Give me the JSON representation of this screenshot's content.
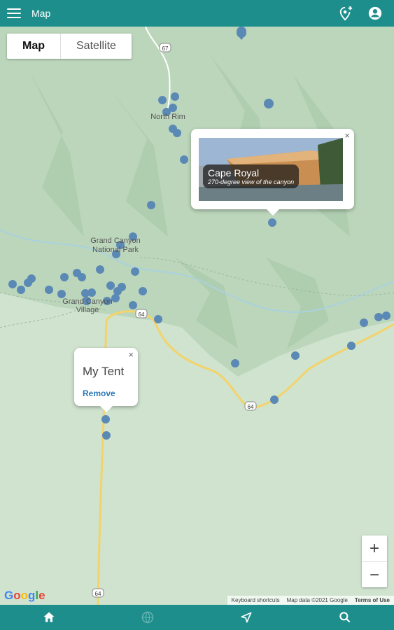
{
  "header": {
    "title": "Map"
  },
  "map_type": {
    "map_label": "Map",
    "satellite_label": "Satellite",
    "selected": "Map"
  },
  "popups": {
    "cape_royal": {
      "title": "Cape Royal",
      "subtitle": "270-degree view of the canyon",
      "close": "×"
    },
    "my_tent": {
      "title": "My Tent",
      "action": "Remove",
      "close": "×"
    }
  },
  "map_labels": {
    "north_rim": "North Rim",
    "park_line1": "Grand Canyon",
    "park_line2": "National Park",
    "village_line1": "Grand Canyon",
    "village_line2": "Village",
    "route_67": "67",
    "route_64a": "64",
    "route_64b": "64",
    "route_64c": "64"
  },
  "zoom": {
    "plus": "+",
    "minus": "−"
  },
  "attribution": {
    "logo": "Google",
    "shortcuts": "Keyboard shortcuts",
    "map_data": "Map data ©2021 Google",
    "terms": "Terms of Use"
  },
  "bottom_nav": [
    "home-icon",
    "globe-icon",
    "navigation-icon",
    "search-icon"
  ],
  "colors": {
    "bar": "#1d8e8c",
    "marker": "#5b89b5",
    "road": "#f3d36a",
    "map_land": "#cfe3cf",
    "map_terrain": "#b9d3b9",
    "water": "#a9d2de"
  }
}
